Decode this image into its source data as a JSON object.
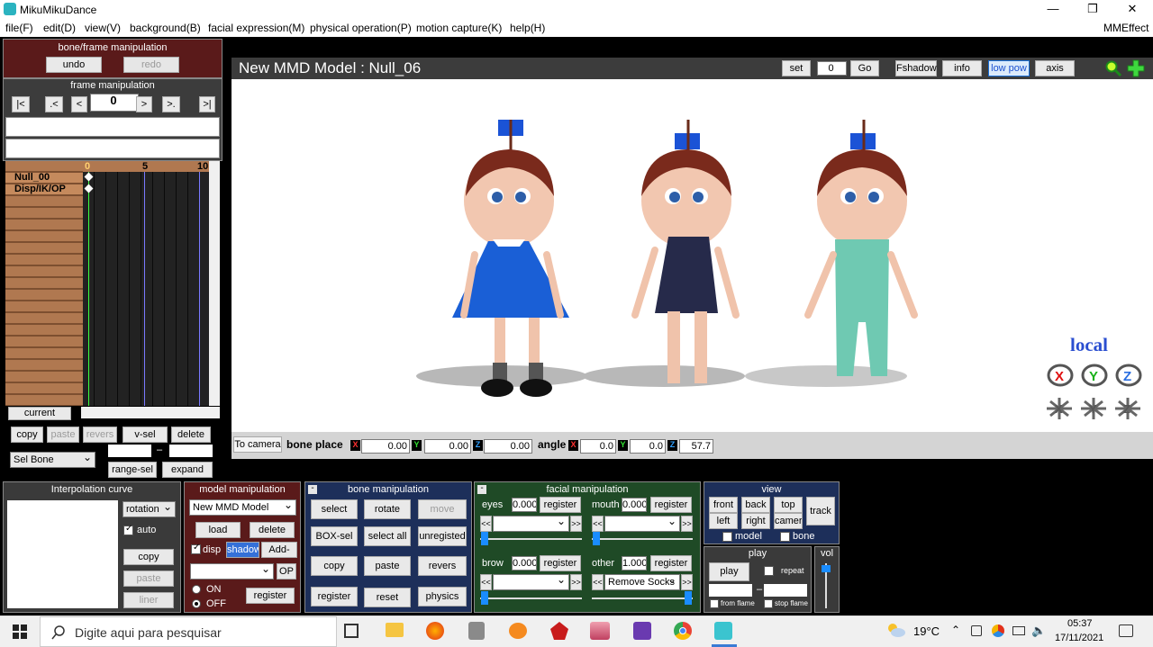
{
  "window": {
    "title": "MikuMikuDance",
    "minimize": "—",
    "restore": "❐",
    "close": "✕"
  },
  "menu": [
    "file(F)",
    "edit(D)",
    "view(V)",
    "background(B)",
    "facial expression(M)",
    "physical operation(P)",
    "motion capture(K)",
    "help(H)"
  ],
  "menu_right": "MMEffect",
  "bone_frame": {
    "title": "bone/frame manipulation",
    "undo": "undo",
    "redo": "redo"
  },
  "frame_manip": {
    "title": "frame manipulation",
    "frame": "0",
    "b_first": "|<",
    "b_prevkey": ".<",
    "b_prev": "<",
    "b_next": ">",
    "b_nextkey": ">.",
    "b_last": ">|"
  },
  "timeline": {
    "ticks": [
      "0",
      "5",
      "10"
    ],
    "rows": [
      "Null_00",
      "Disp/IK/OP"
    ]
  },
  "left_buttons": {
    "current": "current",
    "copy": "copy",
    "paste": "paste",
    "revers": "revers",
    "vsel": "v-sel",
    "delete": "delete",
    "sel_bone": "Sel Bone",
    "range_sel": "range-sel",
    "expand": "expand",
    "dash": "–"
  },
  "viewport": {
    "title": "New MMD Model : Null_06",
    "set": "set",
    "frame": "0",
    "go": "Go",
    "fshadow": "Fshadow",
    "info": "info",
    "low_pow": "low pow",
    "axis": "axis",
    "local": "local"
  },
  "bone_place": {
    "to_camera": "To camera",
    "label": "bone place",
    "x": "0.00",
    "y": "0.00",
    "z": "0.00",
    "angle_label": "angle",
    "ax": "0.0",
    "ay": "0.0",
    "az": "57.7",
    "X": "X",
    "Y": "Y",
    "Z": "Z"
  },
  "interp": {
    "title": "Interpolation curve",
    "mode": "rotation",
    "auto": "auto",
    "copy": "copy",
    "paste": "paste",
    "liner": "liner"
  },
  "model_manip": {
    "title": "model manipulation",
    "model": "New MMD Model",
    "load": "load",
    "delete": "delete",
    "disp": "disp",
    "shadow": "shadow",
    "add_syn": "Add-syn",
    "op": "OP",
    "on": "ON",
    "off": "OFF",
    "register": "register"
  },
  "bone_manip": {
    "title": "bone manipulation",
    "select": "select",
    "rotate": "rotate",
    "move": "move",
    "box_sel": "BOX-sel",
    "select_all": "select all",
    "unregisted": "unregisted",
    "copy": "copy",
    "paste": "paste",
    "revers": "revers",
    "register": "register",
    "reset": "reset",
    "physics": "physics"
  },
  "facial": {
    "title": "facial manipulation",
    "eyes": "eyes",
    "eyes_val": "0.000",
    "mouth": "mouth",
    "mouth_val": "0.000",
    "brow": "brow",
    "brow_val": "0.000",
    "other": "other",
    "other_val": "1.000",
    "other_sel": "Remove Socks",
    "register": "register",
    "prev": "<<",
    "next": ">>"
  },
  "view": {
    "title": "view",
    "front": "front",
    "back": "back",
    "top": "top",
    "track": "track",
    "left": "left",
    "right": "right",
    "camera": "camer",
    "model": "model",
    "bone": "bone"
  },
  "play": {
    "title": "play",
    "play": "play",
    "repeat": "repeat",
    "from_flame": "from flame",
    "stop_flame": "stop flame",
    "vol": "vol",
    "dash": "–"
  },
  "taskbar": {
    "search": "Digite aqui para pesquisar",
    "temp": "19°C",
    "time": "05:37",
    "date": "17/11/2021"
  },
  "colors": {
    "panel_red": "#5a1a1a",
    "panel_blue": "#1d2f5a",
    "panel_green": "#1f4a26",
    "dress_blue": "#1a5fd6",
    "dress_navy": "#262a4a",
    "dress_teal": "#6fc9b2"
  }
}
